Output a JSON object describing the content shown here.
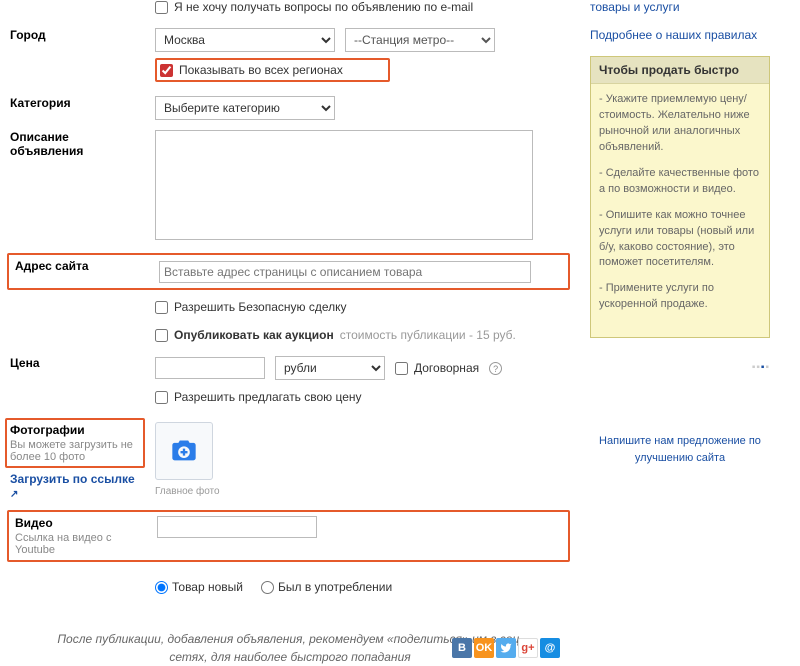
{
  "noemail": {
    "label": "Я не хочу получать вопросы по объявлению по e-mail"
  },
  "city": {
    "label": "Город",
    "value": "Москва",
    "metro_placeholder": "--Станция метро--"
  },
  "allregions": {
    "label": "Показывать во всех регионах"
  },
  "category": {
    "label": "Категория",
    "placeholder": "Выберите категорию"
  },
  "description": {
    "label": "Описание объявления"
  },
  "siteurl": {
    "label": "Адрес сайта",
    "placeholder": "Вставьте адрес страницы с описанием товара"
  },
  "safedeal": {
    "label": "Разрешить Безопасную сделку"
  },
  "auction": {
    "label": "Опубликовать как аукцион",
    "cost": "стоимость публикации - 15 руб."
  },
  "price": {
    "label": "Цена",
    "currency": "рубли",
    "negotiable": "Договорная"
  },
  "offerprice": {
    "label": "Разрешить предлагать свою цену"
  },
  "photos": {
    "label": "Фотографии",
    "hint": "Вы можете загрузить не более 10 фото",
    "uploadlink": "Загрузить по ссылке",
    "mainphoto": "Главное фото"
  },
  "video": {
    "label": "Видео",
    "hint": "Ссылка на видео с Youtube"
  },
  "condition": {
    "opt_new": "Товар новый",
    "opt_used": "Был в употреблении"
  },
  "bottom_note": "После публикации, добавления объявления, рекомендуем «поделиться» им в соц. сетях, для наиболее быстрого попадания",
  "side": {
    "link1": "товары и услуги",
    "link2": "Подробнее о наших правилах",
    "box_title": "Чтобы продать быстро",
    "tip1": "- Укажите приемлемую цену/стоимость. Желательно ниже рыночной или аналогичных объявлений.",
    "tip2": "- Сделайте качественные фото а по возможности и видео.",
    "tip3": "- Опишите как можно точнее услуги или товары (новый или б/у, каково состояние), это поможет посетителям.",
    "tip4": "- Примените услуги по ускоренной продаже.",
    "feedback": "Напишите нам предложение по улучшению сайта"
  }
}
